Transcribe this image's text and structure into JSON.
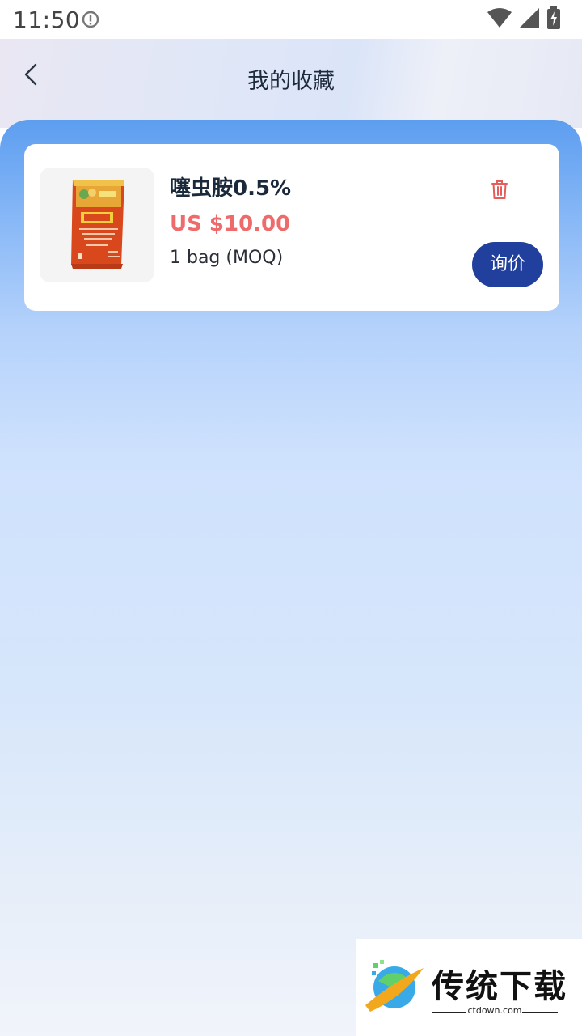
{
  "status_bar": {
    "time": "11:50",
    "icons": [
      "info-icon",
      "wifi-icon",
      "signal-icon",
      "battery-charging-icon"
    ]
  },
  "header": {
    "title": "我的收藏",
    "back_icon": "chevron-left-icon",
    "gradient_colors": [
      "#eae7f3",
      "#dbe5f8",
      "#e6e8f4"
    ]
  },
  "favorites": [
    {
      "name": "噻虫胺0.5%",
      "price": "US $10.00",
      "moq": "1 bag (MOQ)",
      "image_icon": "product-bag-image",
      "delete_icon": "trash-icon",
      "inquire_label": "询价"
    }
  ],
  "watermark": {
    "text": "传统下载",
    "subtext": "ctdown.com"
  },
  "colors": {
    "price": "#ef6b6b",
    "inquire_button": "#213f9c",
    "delete_icon": "#e45c5c",
    "content_top": "#5d9ef0",
    "content_bottom": "#f1f4fa"
  }
}
